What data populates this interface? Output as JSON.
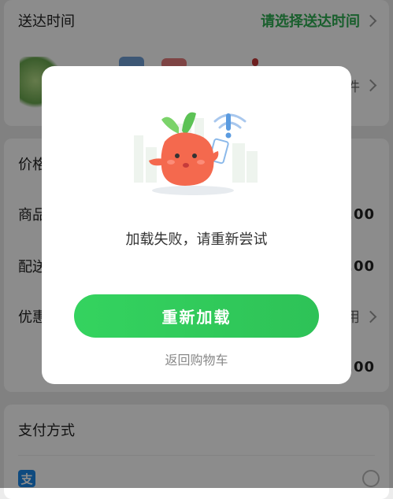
{
  "delivery": {
    "label": "送达时间",
    "value": "请选择送达时间"
  },
  "items_row": {
    "count_suffix": "件"
  },
  "summary": {
    "price_label": "价格",
    "goods_label": "商品",
    "goods_value": ".00",
    "shipping_label": "配送",
    "shipping_value": ".00",
    "discount_label": "优惠",
    "discount_value": "用",
    "total_value": "0.00"
  },
  "payment": {
    "title": "支付方式",
    "alipay_glyph": "支"
  },
  "dialog": {
    "message": "加载失败，请重新尝试",
    "reload_label": "重新加载",
    "back_label": "返回购物车"
  },
  "colors": {
    "accent": "#2fae53",
    "button": "#2ec257",
    "total": "#e94a4a"
  }
}
